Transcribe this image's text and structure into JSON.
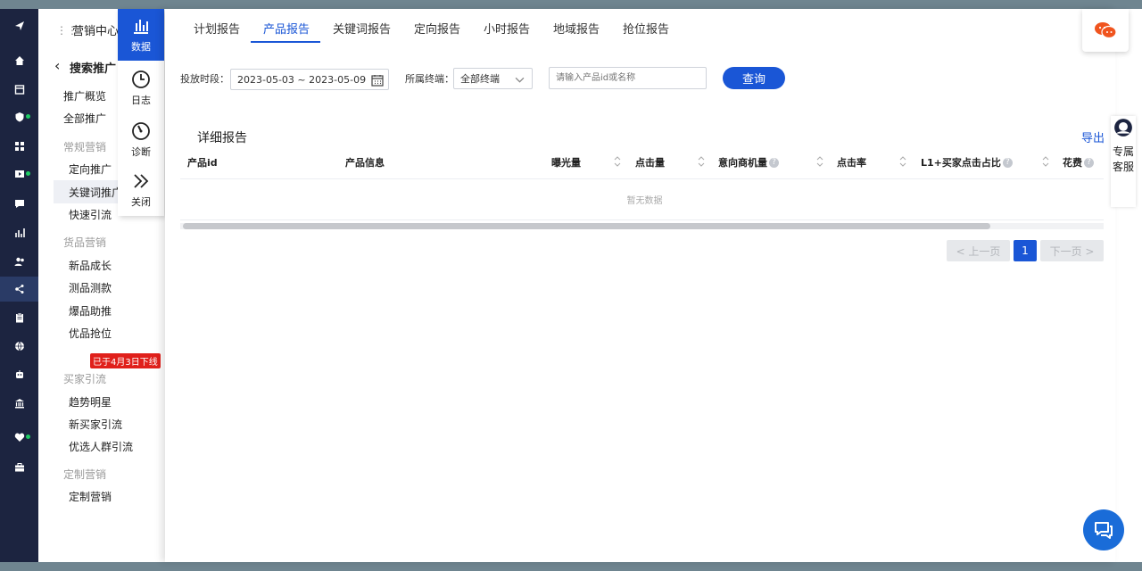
{
  "colors": {
    "accent": "#1a56d6",
    "sidebar_bg": "#1c2440",
    "badge_red": "#e0201b",
    "online_dot": "#1ecb63"
  },
  "iconbar": [
    {
      "icon": "send-icon",
      "dot": false
    },
    {
      "icon": "home-icon",
      "dot": false
    },
    {
      "icon": "store-icon",
      "dot": false
    },
    {
      "icon": "shield-icon",
      "dot": true
    },
    {
      "icon": "apps-icon",
      "dot": false
    },
    {
      "icon": "video-icon",
      "dot": true
    },
    {
      "icon": "message-icon",
      "dot": false
    },
    {
      "icon": "bar-chart-icon",
      "dot": false
    },
    {
      "icon": "users-icon",
      "dot": false
    },
    {
      "icon": "marketing-icon",
      "dot": false,
      "active": true
    },
    {
      "icon": "clipboard-icon",
      "dot": false
    },
    {
      "icon": "globe-icon",
      "dot": false
    },
    {
      "icon": "robot-icon",
      "dot": false
    },
    {
      "icon": "bank-icon",
      "dot": false
    },
    {
      "icon": "heart-icon",
      "dot": true
    },
    {
      "icon": "briefcase-icon",
      "dot": false
    }
  ],
  "subnav": {
    "title": "营销中心",
    "back_label": "搜索推广",
    "items": {
      "overview": "推广概览",
      "all": "全部推广",
      "group_regular": "常规营销",
      "targeting": "定向推广",
      "keyword": "关键词推广",
      "fast": "快速引流",
      "group_goods": "货品营销",
      "new_growth": "新品成长",
      "test": "测品测款",
      "hot": "爆品助推",
      "premium": "优品抢位",
      "offline_badge": "已于4月3日下线",
      "group_buyer": "买家引流",
      "trend": "趋势明星",
      "new_buyer": "新买家引流",
      "crowd": "优选人群引流",
      "group_custom": "定制营销",
      "custom": "定制营销"
    }
  },
  "mode_tabs": [
    {
      "label": "数据",
      "icon": "bar-chart-icon",
      "active": true
    },
    {
      "label": "日志",
      "icon": "clock-icon",
      "active": false
    },
    {
      "label": "诊断",
      "icon": "gauge-icon",
      "active": false
    },
    {
      "label": "关闭",
      "icon": "double-chevron-right-icon",
      "active": false
    }
  ],
  "report_tabs": [
    "计划报告",
    "产品报告",
    "关键词报告",
    "定向报告",
    "小时报告",
    "地域报告",
    "抢位报告"
  ],
  "filters": {
    "period_label": "投放时段：",
    "date_range": "2023-05-03 ~ 2023-05-09",
    "terminal_label": "所属终端：",
    "terminal_value": "全部终端",
    "search_placeholder": "请输入产品id或名称",
    "query_button": "查询"
  },
  "table": {
    "title": "详细报告",
    "export": "导出",
    "columns": [
      "产品id",
      "产品信息",
      "曝光量",
      "点击量",
      "意向商机量",
      "点击率",
      "L1+买家点击占比",
      "花费"
    ],
    "empty_text": "暂无数据"
  },
  "pagination": {
    "prev": "< 上一页",
    "current": "1",
    "next": "下一页 >"
  },
  "service": {
    "label": "专属客服"
  }
}
